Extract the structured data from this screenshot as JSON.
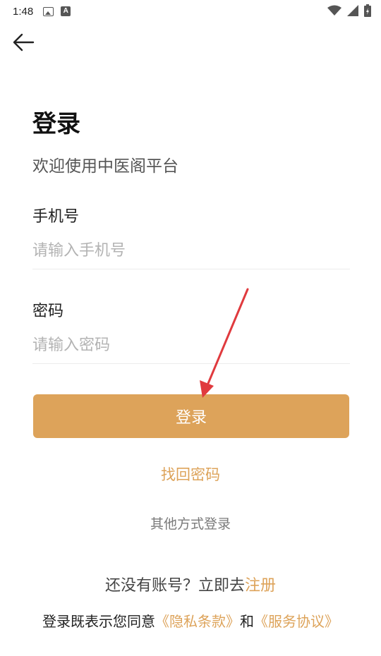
{
  "status_bar": {
    "time": "1:48",
    "left_icons": [
      "image-icon",
      "a-icon"
    ],
    "right_icons": [
      "wifi-icon",
      "signal-icon",
      "battery-icon"
    ]
  },
  "header": {
    "back_icon": "arrow-left-icon"
  },
  "main": {
    "title": "登录",
    "subtitle": "欢迎使用中医阁平台",
    "phone": {
      "label": "手机号",
      "placeholder": "请输入手机号",
      "value": ""
    },
    "password": {
      "label": "密码",
      "placeholder": "请输入密码",
      "value": ""
    },
    "login_button": "登录",
    "find_password": "找回密码",
    "other_login": "其他方式登录"
  },
  "footer": {
    "register_prompt": "还没有账号？立即去",
    "register_link": "注册",
    "agreement_prefix": "登录既表示您同意",
    "privacy_link": "《隐私条款》",
    "agreement_and": "和",
    "service_link": "《服务协议》"
  },
  "colors": {
    "accent": "#dda35a",
    "annotation_arrow": "#e03a3e"
  }
}
